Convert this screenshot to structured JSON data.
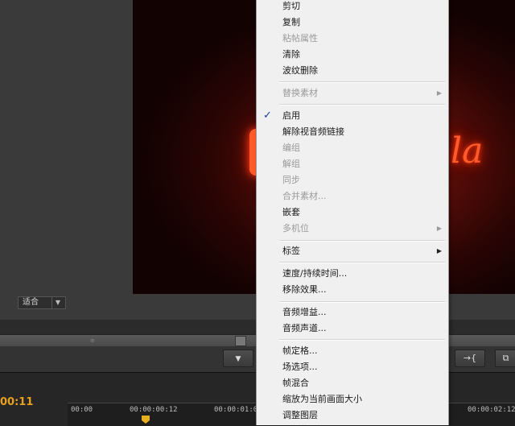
{
  "monitor": {
    "fit_value": "适合",
    "fit_arrow_glyph": "▼",
    "scrub_grip": "≡"
  },
  "transport": {
    "marker_glyph": "▼",
    "insert_glyph": "→{",
    "export_glyph": "⧉"
  },
  "timeline": {
    "timecode": "00:11",
    "ruler": [
      "00:00",
      "00:00:00:12",
      "00:00:01:00",
      "00:00:02:12"
    ]
  },
  "context_menu": {
    "items": [
      {
        "label": "剪切",
        "enabled": true
      },
      {
        "label": "复制",
        "enabled": true
      },
      {
        "label": "粘帖属性",
        "enabled": false
      },
      {
        "label": "清除",
        "enabled": true
      },
      {
        "label": "波纹删除",
        "enabled": true
      },
      {
        "label": "替换素材",
        "enabled": false,
        "submenu": true
      },
      {
        "label": "启用",
        "enabled": true,
        "checked": true
      },
      {
        "label": "解除视音频链接",
        "enabled": true
      },
      {
        "label": "编组",
        "enabled": false
      },
      {
        "label": "解组",
        "enabled": false
      },
      {
        "label": "同步",
        "enabled": false
      },
      {
        "label": "合并素材...",
        "enabled": false
      },
      {
        "label": "嵌套",
        "enabled": true
      },
      {
        "label": "多机位",
        "enabled": false,
        "submenu": true
      },
      {
        "label": "标签",
        "enabled": true,
        "submenu": true
      },
      {
        "label": "速度/持续时间...",
        "enabled": true
      },
      {
        "label": "移除效果...",
        "enabled": true
      },
      {
        "label": "音频增益...",
        "enabled": true
      },
      {
        "label": "音频声道...",
        "enabled": true
      },
      {
        "label": "帧定格...",
        "enabled": true
      },
      {
        "label": "场选项...",
        "enabled": true
      },
      {
        "label": "帧混合",
        "enabled": true
      },
      {
        "label": "缩放为当前画面大小",
        "enabled": true
      },
      {
        "label": "调整图层",
        "enabled": true
      }
    ],
    "check_glyph": "✓",
    "submenu_glyph": "▶"
  }
}
